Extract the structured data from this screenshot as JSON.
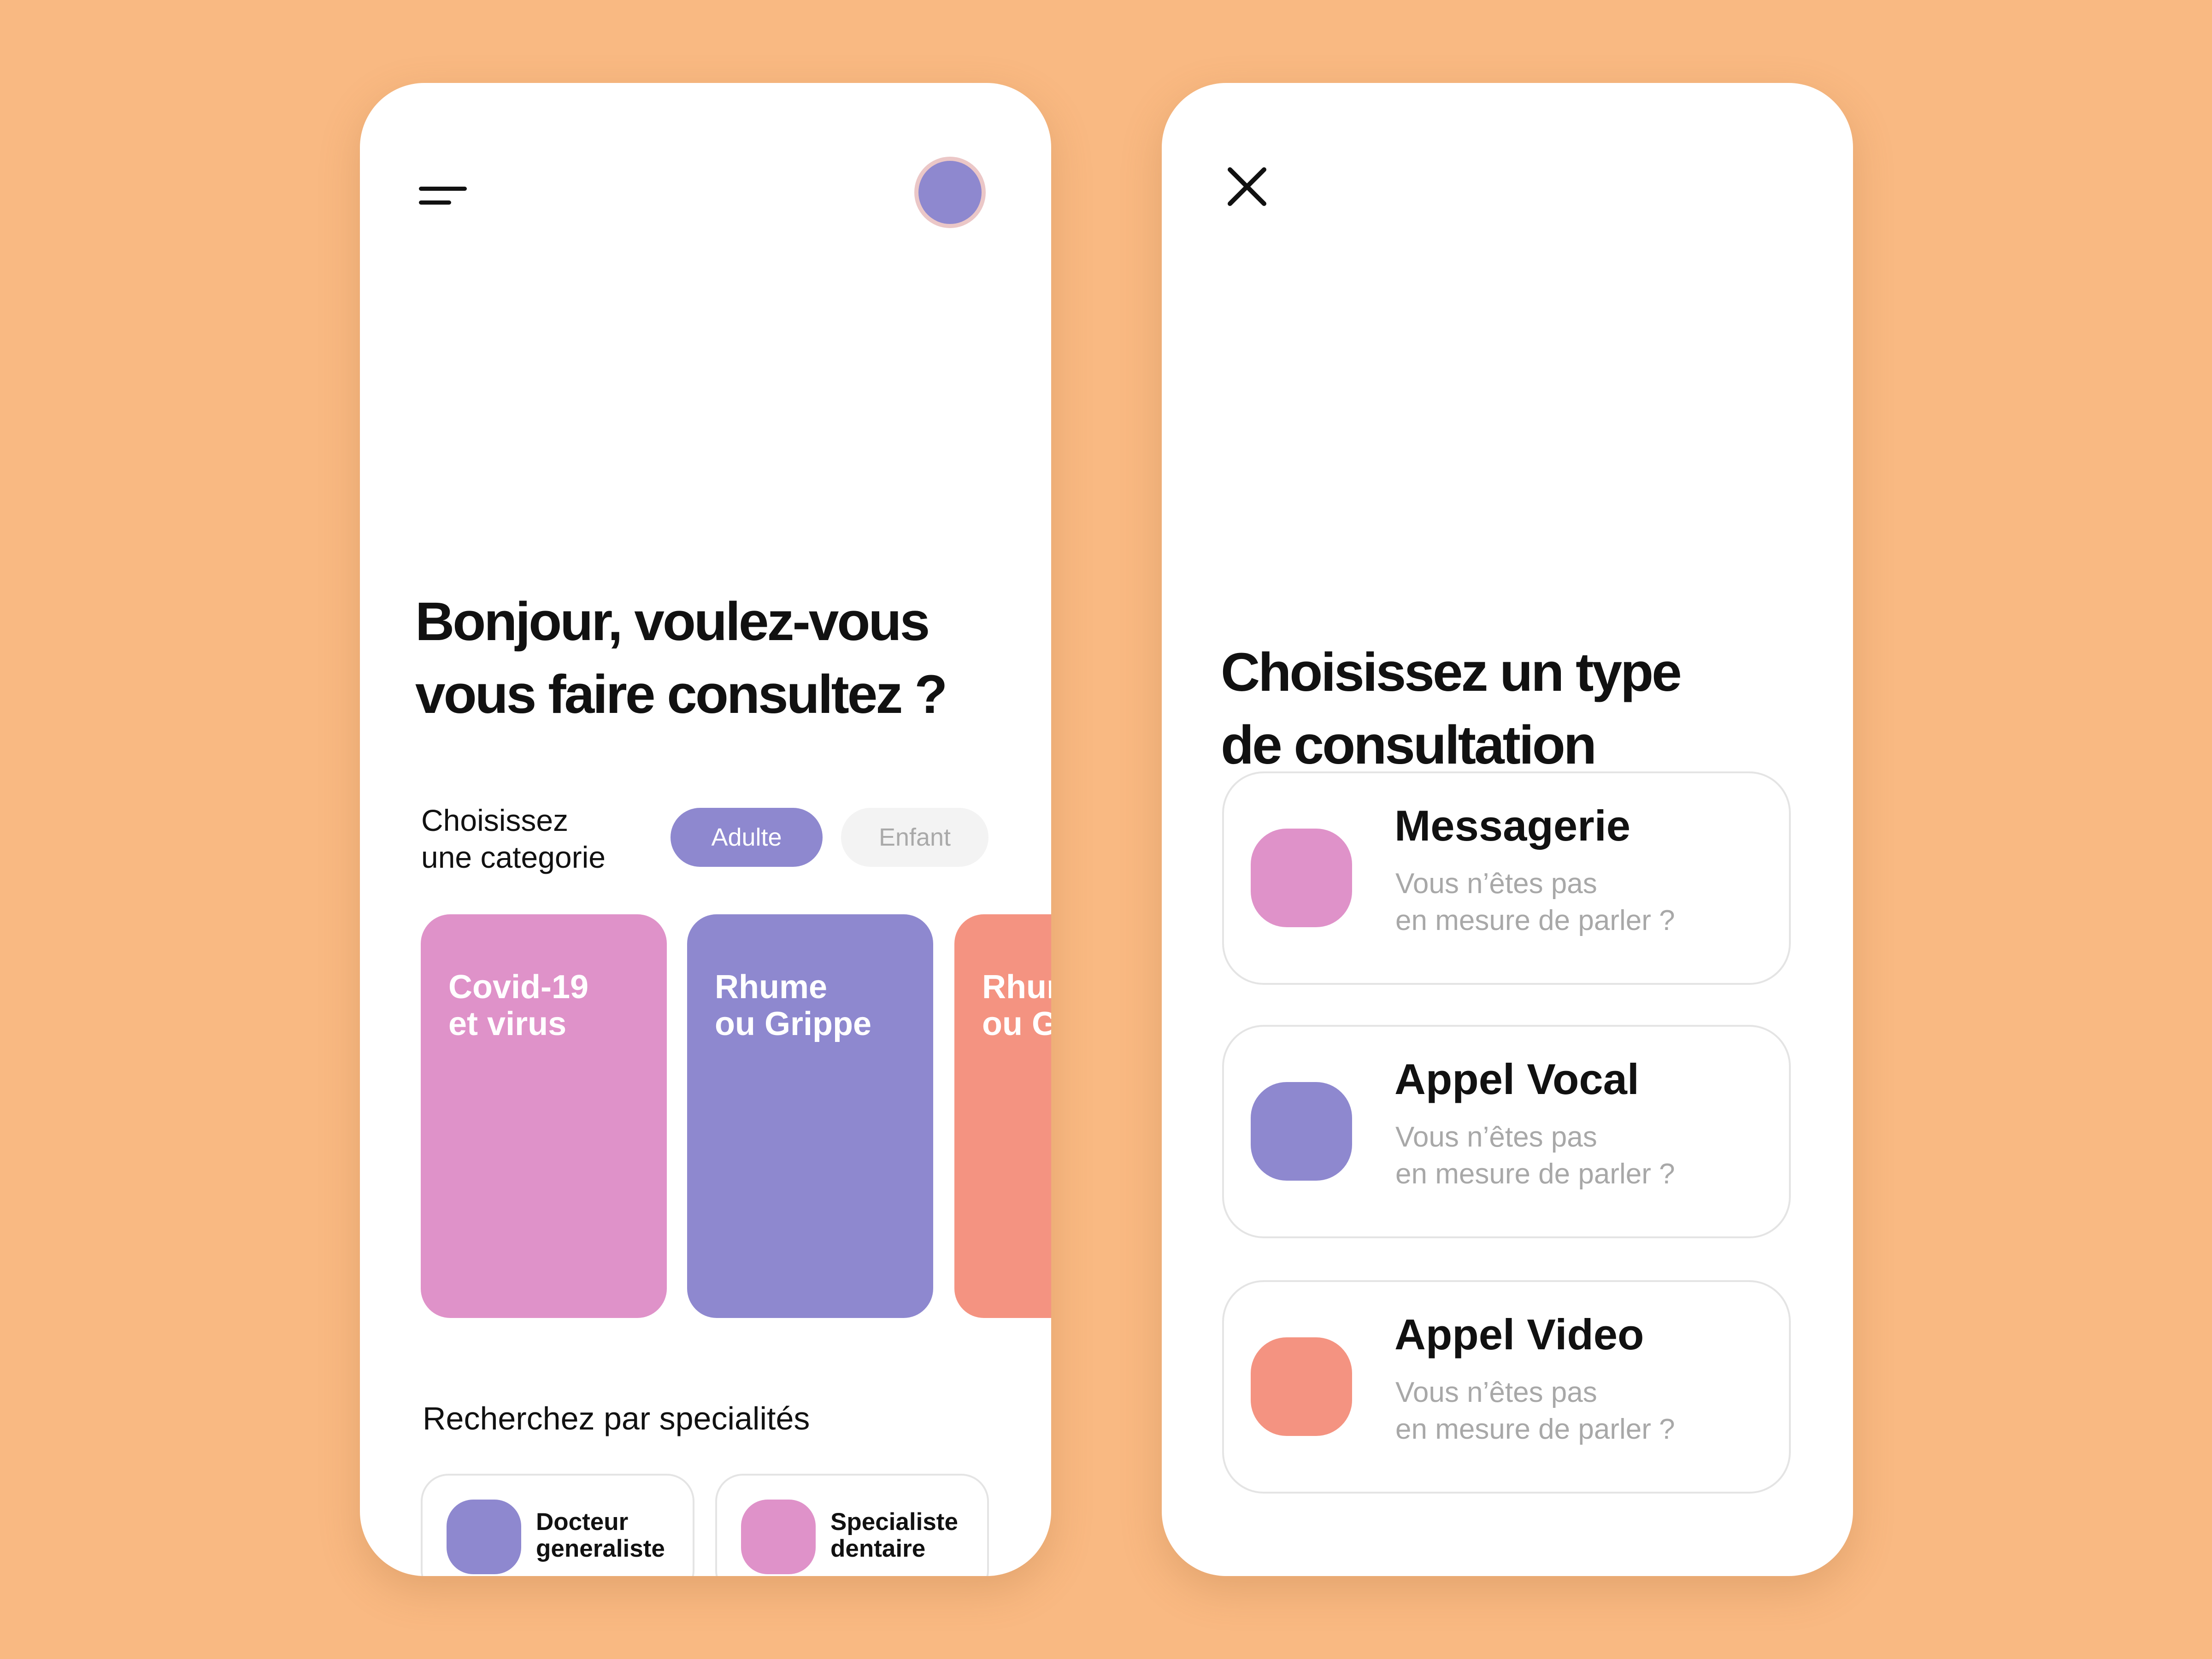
{
  "colors": {
    "background": "#F9B982",
    "purple": "#8E88CF",
    "pink": "#DF92C9",
    "salmon": "#F49381",
    "text": "#111111",
    "muted": "#A8A8A8"
  },
  "home": {
    "menu_icon": "menu-icon",
    "avatar_icon": "avatar",
    "headline": [
      "Bonjour, voulez-vous",
      "vous faire consultez ?"
    ],
    "category_label": [
      "Choisissez",
      "une categorie"
    ],
    "tabs": [
      {
        "label": "Adulte",
        "active": true
      },
      {
        "label": "Enfant",
        "active": false
      }
    ],
    "categories": [
      {
        "lines": [
          "Covid-19",
          "et virus"
        ],
        "color": "#DF92C9"
      },
      {
        "lines": [
          "Rhume",
          "ou Grippe"
        ],
        "color": "#8E88CF"
      },
      {
        "lines": [
          "Rhume",
          "ou Grippe"
        ],
        "color": "#F49381"
      }
    ],
    "specialties_title": "Recherchez par specialités",
    "specialties": [
      {
        "lines": [
          "Docteur",
          "generaliste"
        ],
        "color": "#8E88CF"
      },
      {
        "lines": [
          "Specialiste",
          "dentaire"
        ],
        "color": "#DF92C9"
      }
    ]
  },
  "consultation": {
    "close_icon": "close-icon",
    "headline": [
      "Choisissez un type",
      "de consultation"
    ],
    "options": [
      {
        "title": "Messagerie",
        "subtitle": [
          "Vous n’êtes pas",
          "en mesure de parler ?"
        ],
        "color": "#DF92C9"
      },
      {
        "title": "Appel Vocal",
        "subtitle": [
          "Vous n’êtes pas",
          "en mesure de parler ?"
        ],
        "color": "#8E88CF"
      },
      {
        "title": "Appel Video",
        "subtitle": [
          "Vous n’êtes pas",
          "en mesure de parler ?"
        ],
        "color": "#F49381"
      }
    ]
  }
}
